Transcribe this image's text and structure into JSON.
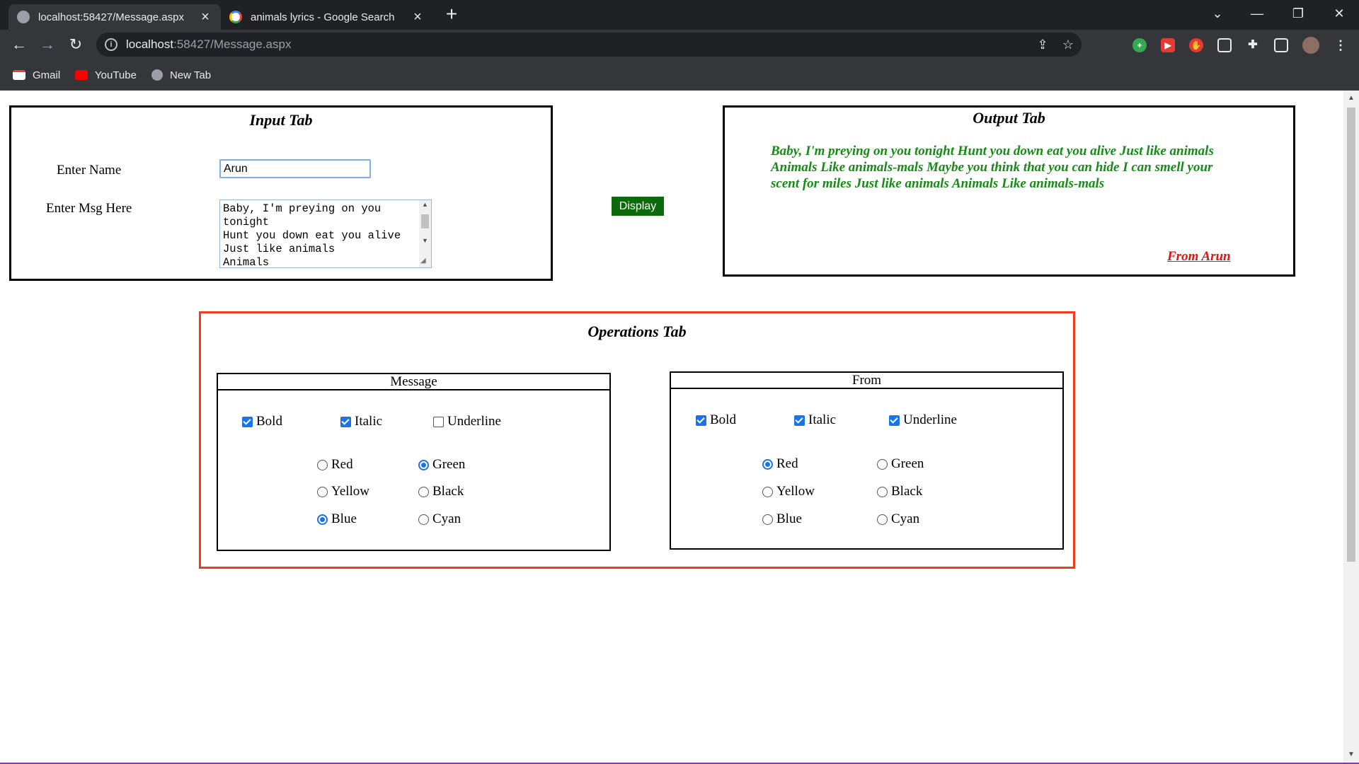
{
  "browser": {
    "tabs": [
      {
        "title": "localhost:58427/Message.aspx",
        "active": true
      },
      {
        "title": "animals lyrics - Google Search",
        "active": false
      }
    ],
    "url_host": "localhost",
    "url_rest": ":58427/Message.aspx",
    "bookmarks": [
      {
        "label": "Gmail",
        "icon": "gmail-icon"
      },
      {
        "label": "YouTube",
        "icon": "youtube-icon"
      },
      {
        "label": "New Tab",
        "icon": "globe-icon"
      }
    ]
  },
  "input_tab": {
    "heading": "Input Tab",
    "name_label": "Enter Name",
    "name_value": "Arun",
    "msg_label": "Enter Msg Here",
    "msg_value": "Baby, I'm preying on you tonight\nHunt you down eat you alive\nJust like animals\nAnimals"
  },
  "display_button": "Display",
  "output_tab": {
    "heading": "Output Tab",
    "message": "Baby, I'm preying on you tonight Hunt you down eat you alive Just like animals Animals Like animals-mals Maybe you think that you can hide I can smell your scent for miles Just like animals Animals Like animals-mals",
    "message_color": "#178a17",
    "from": "From Arun",
    "from_color": "#e81010"
  },
  "operations_tab": {
    "heading": "Operations Tab",
    "message_group": {
      "legend": "Message",
      "styles": [
        {
          "label": "Bold",
          "checked": true
        },
        {
          "label": "Italic",
          "checked": true
        },
        {
          "label": "Underline",
          "checked": false
        }
      ],
      "colors": [
        {
          "label": "Red",
          "selected": false
        },
        {
          "label": "Green",
          "selected": true
        },
        {
          "label": "Yellow",
          "selected": false
        },
        {
          "label": "Black",
          "selected": false
        },
        {
          "label": "Blue",
          "selected": true
        },
        {
          "label": "Cyan",
          "selected": false
        }
      ]
    },
    "from_group": {
      "legend": "From",
      "styles": [
        {
          "label": "Bold",
          "checked": true
        },
        {
          "label": "Italic",
          "checked": true
        },
        {
          "label": "Underline",
          "checked": true
        }
      ],
      "colors": [
        {
          "label": "Red",
          "selected": true
        },
        {
          "label": "Green",
          "selected": false
        },
        {
          "label": "Yellow",
          "selected": false
        },
        {
          "label": "Black",
          "selected": false
        },
        {
          "label": "Blue",
          "selected": false
        },
        {
          "label": "Cyan",
          "selected": false
        }
      ]
    }
  },
  "colors": {
    "accent": "#1a73e8",
    "ops_border": "#f03c1e",
    "display_button_bg": "#0b6b0b"
  }
}
